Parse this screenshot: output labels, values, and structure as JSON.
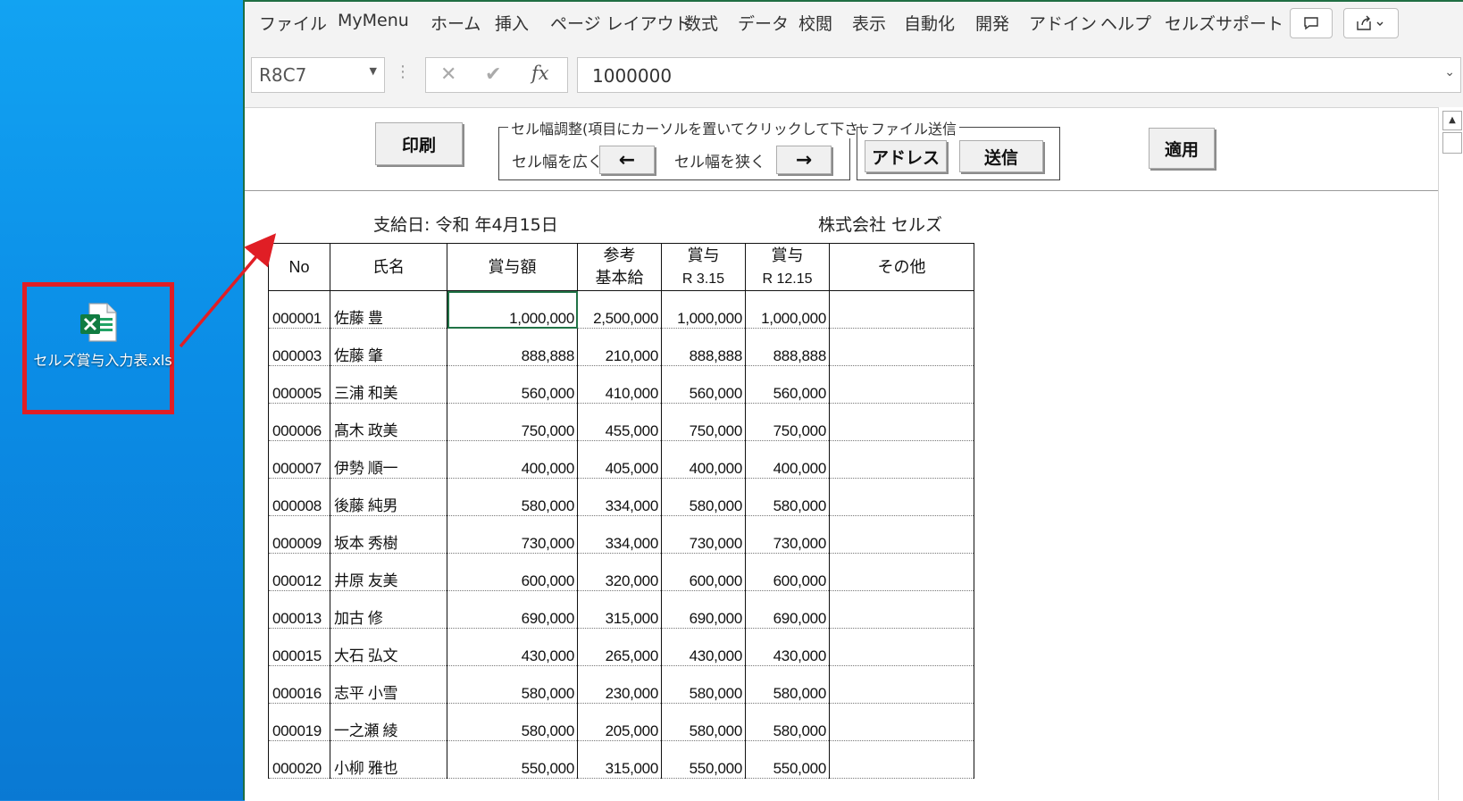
{
  "desktop": {
    "file_label": "セルズ賞与入力表.xls"
  },
  "menu": {
    "items": [
      "ファイル",
      "MyMenu",
      "ホーム",
      "挿入",
      "ページ レイアウト",
      "数式",
      "データ",
      "校閲",
      "表示",
      "自動化",
      "開発",
      "アドイン",
      "ヘルプ",
      "セルズサポート"
    ]
  },
  "formula_bar": {
    "name_box": "R8C7",
    "fx_label": "fx",
    "value": "1000000"
  },
  "controls": {
    "print_button": "印刷",
    "width_group_legend": "セル幅調整(項目にカーソルを置いてクリックして下さい)",
    "widen_label": "セル幅を広く",
    "widen_button": "←",
    "narrow_label": "セル幅を狭く",
    "narrow_button": "→",
    "send_group_legend": "ファイル送信",
    "address_button": "アドレス",
    "send_button": "送信",
    "apply_button": "適用"
  },
  "sheet_header": {
    "pay_date": "支給日:  令和  年4月15日",
    "company": "株式会社  セルズ"
  },
  "table": {
    "headers": [
      {
        "line1": "No",
        "line2": ""
      },
      {
        "line1": "氏名",
        "line2": ""
      },
      {
        "line1": "賞与額",
        "line2": ""
      },
      {
        "line1": "参考",
        "line2": "基本給"
      },
      {
        "line1": "賞与",
        "line2": "R  3.15"
      },
      {
        "line1": "賞与",
        "line2": "R  12.15"
      },
      {
        "line1": "その他",
        "line2": ""
      }
    ],
    "rows": [
      [
        "000001",
        "佐藤 豊",
        "1,000,000",
        "2,500,000",
        "1,000,000",
        "1,000,000",
        ""
      ],
      [
        "000003",
        "佐藤 肇",
        "888,888",
        "210,000",
        "888,888",
        "888,888",
        ""
      ],
      [
        "000005",
        "三浦  和美",
        "560,000",
        "410,000",
        "560,000",
        "560,000",
        ""
      ],
      [
        "000006",
        "髙木 政美",
        "750,000",
        "455,000",
        "750,000",
        "750,000",
        ""
      ],
      [
        "000007",
        "伊勢  順一",
        "400,000",
        "405,000",
        "400,000",
        "400,000",
        ""
      ],
      [
        "000008",
        "後藤 純男",
        "580,000",
        "334,000",
        "580,000",
        "580,000",
        ""
      ],
      [
        "000009",
        "坂本 秀樹",
        "730,000",
        "334,000",
        "730,000",
        "730,000",
        ""
      ],
      [
        "000012",
        "井原 友美",
        "600,000",
        "320,000",
        "600,000",
        "600,000",
        ""
      ],
      [
        "000013",
        "加古 修",
        "690,000",
        "315,000",
        "690,000",
        "690,000",
        ""
      ],
      [
        "000015",
        "大石 弘文",
        "430,000",
        "265,000",
        "430,000",
        "430,000",
        ""
      ],
      [
        "000016",
        "志平 小雪",
        "580,000",
        "230,000",
        "580,000",
        "580,000",
        ""
      ],
      [
        "000019",
        "一之瀬 綾",
        "580,000",
        "205,000",
        "580,000",
        "580,000",
        ""
      ],
      [
        "000020",
        "小柳 雅也",
        "550,000",
        "315,000",
        "550,000",
        "550,000",
        ""
      ]
    ]
  },
  "colors": {
    "excel_green": "#217346",
    "highlight_red": "#e01e25"
  }
}
